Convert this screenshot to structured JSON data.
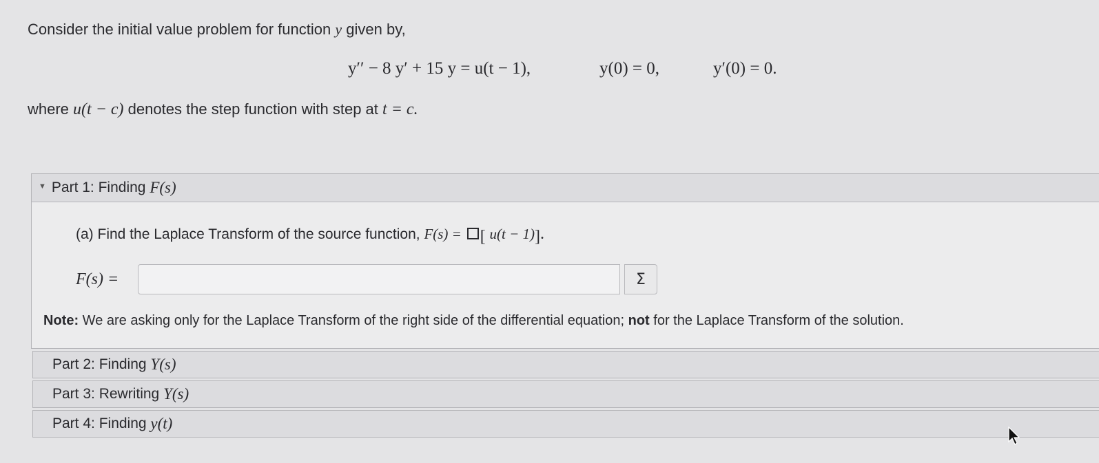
{
  "intro": {
    "text": "Consider the initial value problem for function",
    "var": "y",
    "suffix": "given by,"
  },
  "equation": {
    "main_lhs": "y′′ − 8 y′ + 15 y =",
    "main_rhs": "u(t − 1),",
    "ic1": "y(0) = 0,",
    "ic2": "y′(0) = 0."
  },
  "where_line": {
    "prefix": "where",
    "func": "u(t − c)",
    "middle": "denotes the step function with step at",
    "cond": "t = c."
  },
  "part1": {
    "title_text": "Part 1: Finding",
    "title_math": "F(s)",
    "question_text": "(a) Find the Laplace Transform of the source function,",
    "question_math_lhs": "F(s) =",
    "question_math_arg": "u(t − 1)",
    "answer_label": "F(s) =",
    "answer_value": "",
    "sigma_label": "Σ",
    "note_bold": "Note:",
    "note_text1": "We are asking only for the Laplace Transform of the right side of the differential equation;",
    "note_not": "not",
    "note_text2": "for the Laplace Transform of the solution."
  },
  "part2": {
    "title_text": "Part 2: Finding",
    "title_math": "Y(s)"
  },
  "part3": {
    "title_text": "Part 3: Rewriting",
    "title_math": "Y(s)"
  },
  "part4": {
    "title_text": "Part 4: Finding",
    "title_math": "y(t)"
  },
  "icons": {
    "cursor": "mouse-pointer-icon",
    "caret": "triangle-down-icon"
  }
}
